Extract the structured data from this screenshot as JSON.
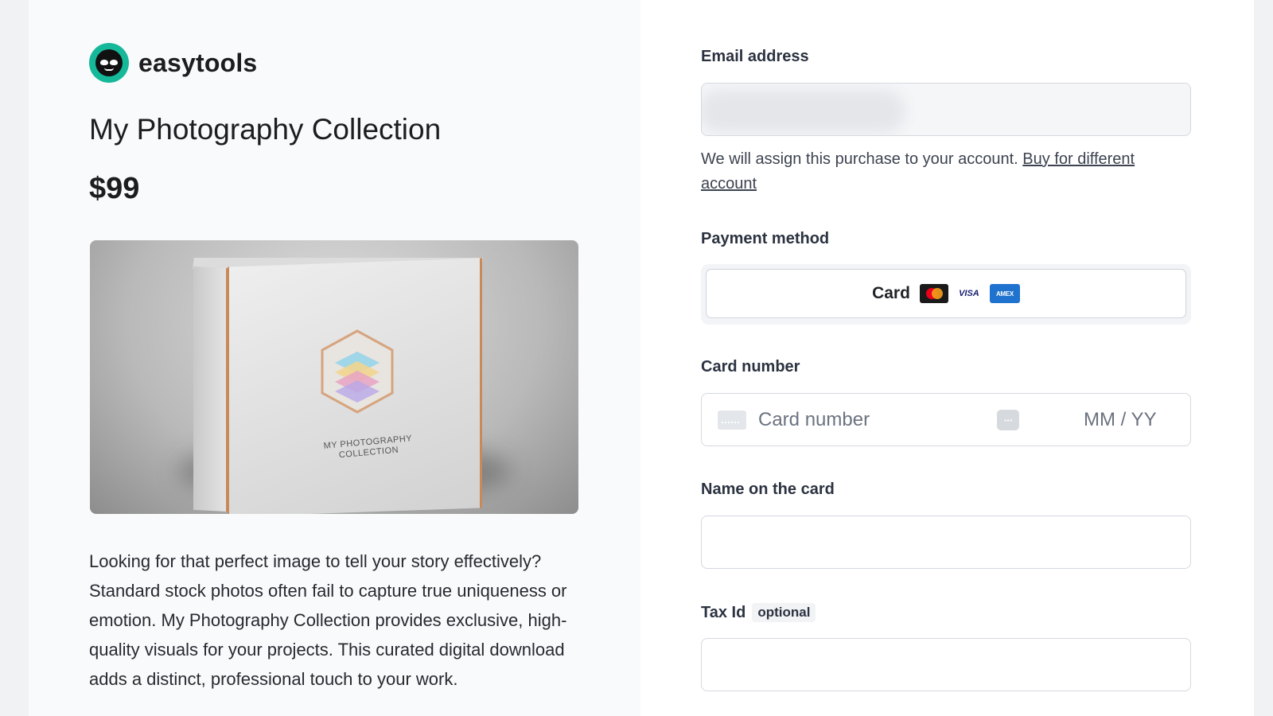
{
  "brand": {
    "name": "easytools"
  },
  "product": {
    "title": "My Photography Collection",
    "price": "$99",
    "image_text": "MY PHOTOGRAPHY COLLECTION",
    "description": "Looking for that perfect image to tell your story effectively? Standard stock photos often fail to capture true uniqueness or emotion. My Photography Collection provides exclusive, high-quality visuals for your projects. This curated digital download adds a distinct, professional touch to your work."
  },
  "checkout": {
    "email": {
      "label": "Email address",
      "value": "",
      "assign_text": "We will assign this purchase to your account.",
      "assign_link": "Buy for different account"
    },
    "payment": {
      "label": "Payment method",
      "method_label": "Card",
      "icons": [
        "mastercard-icon",
        "visa-icon",
        "amex-icon"
      ],
      "visa_text": "VISA",
      "amex_text": "AMEX"
    },
    "card": {
      "label": "Card number",
      "number_placeholder": "Card number",
      "expiry_placeholder": "MM / YY",
      "cvc_glyph": "···"
    },
    "name": {
      "label": "Name on the card",
      "value": ""
    },
    "tax": {
      "label": "Tax Id",
      "optional_badge": "optional",
      "value": ""
    }
  },
  "colors": {
    "accent": "#16b89a",
    "page_bg": "#f1f2f4",
    "left_panel_bg": "#f9fafb",
    "right_panel_bg": "#ffffff",
    "border": "#d4d8de"
  }
}
